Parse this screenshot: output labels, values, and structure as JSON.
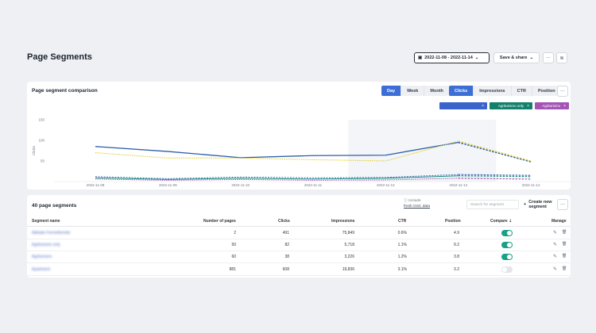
{
  "header": {
    "title": "Page Segments",
    "date_range": "2022-11-08 - 2022-11-14",
    "save_share": "Save & share",
    "more": "···",
    "layers": "≋"
  },
  "comparison": {
    "title": "Page segment comparison",
    "periods": [
      "Day",
      "Week",
      "Month"
    ],
    "metrics": [
      "Clicks",
      "Impressions",
      "CTR",
      "Position"
    ],
    "more": "···",
    "tags": [
      {
        "label": "",
        "color": "#3a64cc"
      },
      {
        "label": "Agriturismo only",
        "color": "#12806b"
      },
      {
        "label": "Agriturismo",
        "color": "#a454b5"
      }
    ]
  },
  "chart_data": {
    "type": "line",
    "ylabel": "Clicks",
    "y_ticks": [
      "150",
      "100",
      "50"
    ],
    "ylim": [
      0,
      150
    ],
    "x": [
      "2022-11-08",
      "2022-11-09",
      "2022-11-10",
      "2022-11-11",
      "2022-11-12",
      "2022-11-13",
      "2022-11-14"
    ],
    "series": [
      {
        "color": "#2b5eab",
        "values": [
          85,
          73,
          58,
          63,
          64,
          95,
          48
        ]
      },
      {
        "color": "#e3cf3a",
        "values": [
          70,
          57,
          57,
          53,
          50,
          98,
          50
        ]
      },
      {
        "color": "#16917f",
        "values": [
          9,
          5,
          8,
          6,
          8,
          14,
          12
        ]
      },
      {
        "color": "#a454b5",
        "values": [
          6,
          3,
          5,
          3,
          4,
          8,
          6
        ]
      },
      {
        "color": "#2b5eab",
        "values": [
          12,
          7,
          11,
          9,
          10,
          17,
          15
        ]
      }
    ]
  },
  "segments": {
    "title": "40 page segments",
    "include_line1": "Include",
    "include_line2": "fresh GSC data",
    "search_placeholder": "Search for segment",
    "create": "Create new segment",
    "more": "···",
    "columns": [
      "Segment name",
      "Number of pages",
      "Clicks",
      "Impressions",
      "CTR",
      "Position",
      "Compare",
      "Manage"
    ],
    "rows": [
      {
        "name": "Abbiate Fermetterede",
        "pages": "2",
        "clicks": "491",
        "impressions": "75,849",
        "ctr": "0.6%",
        "position": "4.9",
        "compare": true
      },
      {
        "name": "Agriturismo only",
        "pages": "50",
        "clicks": "82",
        "impressions": "5,718",
        "ctr": "1.1%",
        "position": "9.2",
        "compare": true
      },
      {
        "name": "Agriturismo",
        "pages": "60",
        "clicks": "38",
        "impressions": "3,226",
        "ctr": "1.2%",
        "position": "3.8",
        "compare": true
      },
      {
        "name": "Apartment",
        "pages": "881",
        "clicks": "608",
        "impressions": "19,836",
        "ctr": "3.1%",
        "position": "3.2",
        "compare": false
      }
    ]
  }
}
